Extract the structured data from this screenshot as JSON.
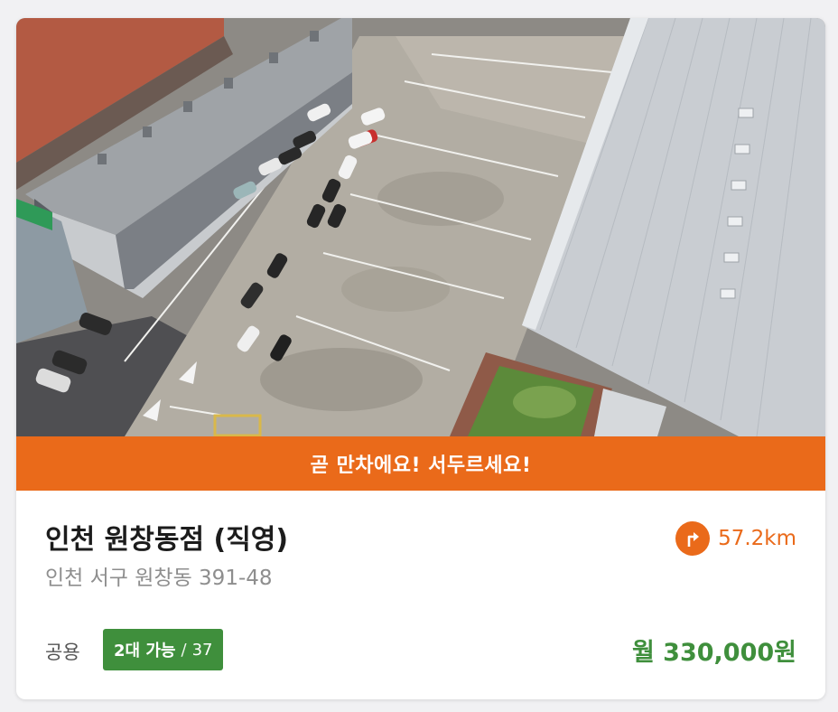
{
  "banner": {
    "text": "곧 만차에요! 서두르세요!"
  },
  "lot": {
    "name": "인천 원창동점 (직영)",
    "address": "인천 서구 원창동 391-48",
    "distance": "57.2km",
    "type": "공용",
    "available": "2대 가능",
    "separator": "/",
    "total": "37",
    "price": "월 330,000원"
  },
  "colors": {
    "accent_orange": "#ea6a1a",
    "accent_green": "#3f8f3c"
  },
  "icons": {
    "direction": "turn-right-arrow-icon"
  }
}
